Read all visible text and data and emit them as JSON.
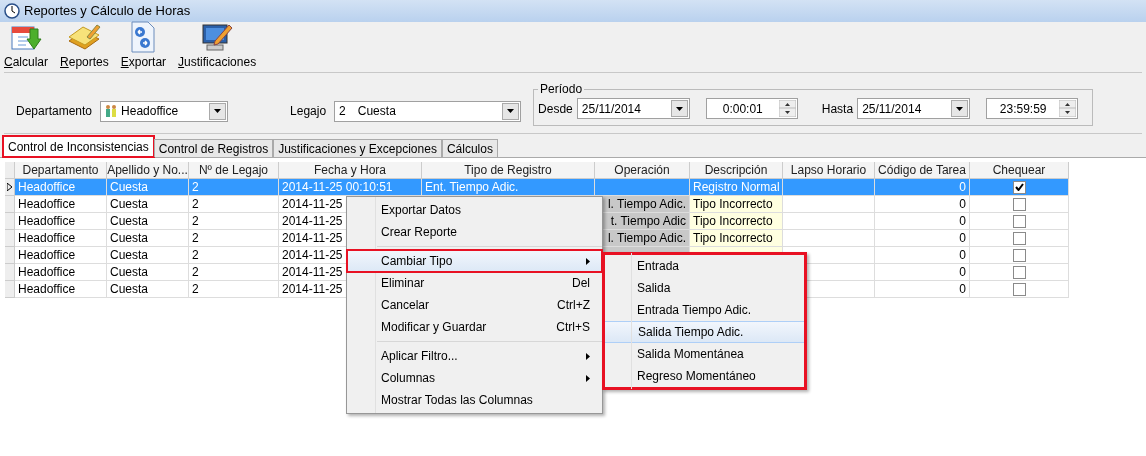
{
  "window": {
    "title": "Reportes y Cálculo de Horas"
  },
  "toolbar": [
    {
      "label": "Calcular",
      "kind": "calc"
    },
    {
      "label": "Reportes",
      "kind": "notes"
    },
    {
      "label": "Exportar",
      "kind": "export"
    },
    {
      "label": "Justificaciones",
      "kind": "justify"
    }
  ],
  "filters": {
    "department": {
      "label": "Departamento",
      "value": "Headoffice"
    },
    "employee": {
      "label": "Legajo",
      "number": "2",
      "name": "Cuesta"
    },
    "period": {
      "title": "Período",
      "from_label": "Desde",
      "from_date": "25/11/2014",
      "from_time": "0:00:01",
      "to_label": "Hasta",
      "to_date": "25/11/2014",
      "to_time": "23:59:59"
    }
  },
  "tabs": [
    {
      "label": "Control de Inconsistencias",
      "selected": true,
      "highlighted": true
    },
    {
      "label": "Control de Registros",
      "selected": false,
      "highlighted": false
    },
    {
      "label": "Justificaciones y Excepciones",
      "selected": false,
      "highlighted": false
    },
    {
      "label": "Cálculos",
      "selected": false,
      "highlighted": false
    }
  ],
  "table": {
    "columns": [
      "Departamento",
      "Apellido y No...",
      "Nº de Legajo",
      "Fecha y Hora",
      "Tipo de Registro",
      "Operación",
      "Descripción",
      "Lapso Horario",
      "Código de Tarea",
      "Chequear"
    ],
    "rows": [
      {
        "selected": true,
        "flagged": false,
        "checked": true,
        "cells": [
          "Headoffice",
          "Cuesta",
          "2",
          "2014-11-25 00:10:51",
          "Ent. Tiempo Adic.",
          null,
          "Registro Normal",
          null,
          "0"
        ]
      },
      {
        "selected": false,
        "flagged": true,
        "checked": false,
        "cells": [
          "Headoffice",
          "Cuesta",
          "2",
          "2014-11-25",
          null,
          "l. Tiempo Adic.",
          "Tipo Incorrecto",
          null,
          "0"
        ]
      },
      {
        "selected": false,
        "flagged": true,
        "checked": false,
        "cells": [
          "Headoffice",
          "Cuesta",
          "2",
          "2014-11-25",
          null,
          "t. Tiempo Adic",
          "Tipo Incorrecto",
          null,
          "0"
        ]
      },
      {
        "selected": false,
        "flagged": true,
        "checked": false,
        "cells": [
          "Headoffice",
          "Cuesta",
          "2",
          "2014-11-25",
          null,
          "l. Tiempo Adic.",
          "Tipo Incorrecto",
          null,
          "0"
        ]
      },
      {
        "selected": false,
        "flagged": true,
        "checked": false,
        "cells": [
          "Headoffice",
          "Cuesta",
          "2",
          "2014-11-25",
          null,
          null,
          null,
          null,
          "0"
        ]
      },
      {
        "selected": false,
        "checked": false,
        "cells": [
          "Headoffice",
          "Cuesta",
          "2",
          "2014-11-25",
          null,
          null,
          null,
          null,
          "0"
        ]
      },
      {
        "selected": false,
        "checked": false,
        "cells": [
          "Headoffice",
          "Cuesta",
          "2",
          "2014-11-25",
          null,
          null,
          null,
          null,
          "0"
        ]
      }
    ]
  },
  "context_menu": {
    "items": [
      {
        "kind": "item",
        "label": "Exportar Datos",
        "selected": false,
        "highlighted": false
      },
      {
        "kind": "item",
        "label": "Crear Reporte",
        "selected": false,
        "highlighted": false
      },
      {
        "kind": "separator"
      },
      {
        "kind": "submenu",
        "label": "Cambiar Tipo",
        "selected": true,
        "highlighted": true
      },
      {
        "kind": "item",
        "label": "Eliminar",
        "shortcut": "Del",
        "selected": false,
        "highlighted": false
      },
      {
        "kind": "item",
        "label": "Cancelar",
        "shortcut": "Ctrl+Z",
        "selected": false,
        "highlighted": false
      },
      {
        "kind": "item",
        "label": "Modificar y Guardar",
        "shortcut": "Ctrl+S",
        "selected": false,
        "highlighted": false
      },
      {
        "kind": "separator"
      },
      {
        "kind": "submenu",
        "label": "Aplicar Filtro...",
        "selected": false,
        "highlighted": false
      },
      {
        "kind": "submenu",
        "label": "Columnas",
        "selected": false,
        "highlighted": false
      },
      {
        "kind": "item",
        "label": "Mostrar Todas las Columnas",
        "selected": false,
        "highlighted": false
      }
    ]
  },
  "submenu": {
    "highlighted": true,
    "items": [
      {
        "label": "Entrada",
        "selected": false
      },
      {
        "label": "Salida",
        "selected": false
      },
      {
        "label": "Entrada Tiempo Adic.",
        "selected": false
      },
      {
        "label": "Salida Tiempo Adic.",
        "selected": true
      },
      {
        "label": "Salida Momentánea",
        "selected": false
      },
      {
        "label": "Regreso Momentáneo",
        "selected": false
      }
    ]
  }
}
